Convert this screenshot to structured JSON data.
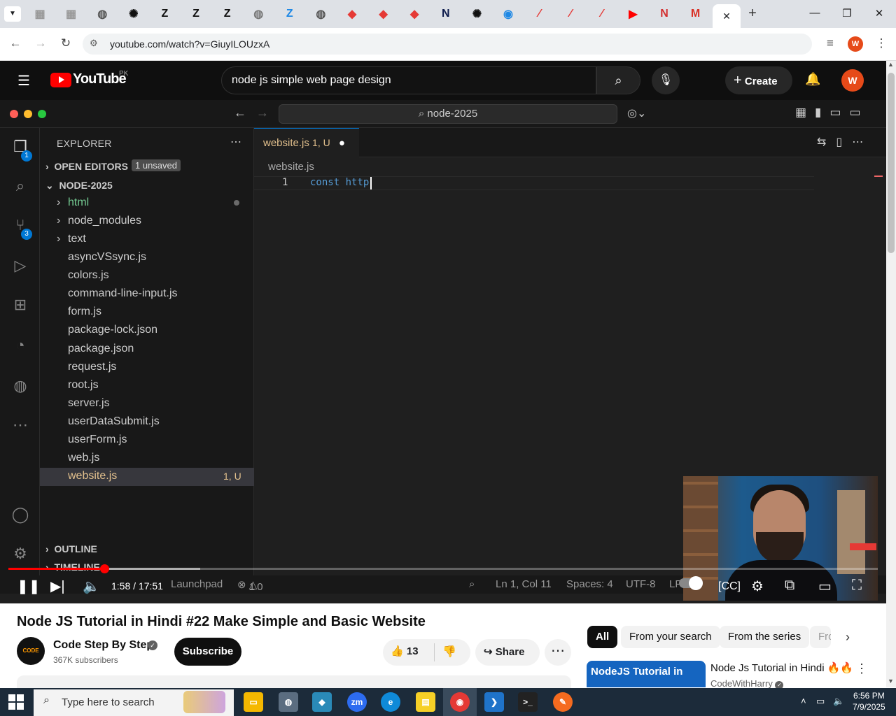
{
  "browser": {
    "url": "youtube.com/watch?v=GiuyILOUzxA",
    "tabs": [
      {
        "icon": "page-icon",
        "color": "#999"
      },
      {
        "icon": "page-icon",
        "color": "#999"
      },
      {
        "icon": "globe-icon",
        "color": "#555"
      },
      {
        "icon": "openai-icon",
        "color": "#111"
      },
      {
        "icon": "z-icon",
        "color": "#111"
      },
      {
        "icon": "z-icon",
        "color": "#111"
      },
      {
        "icon": "z-icon",
        "color": "#111"
      },
      {
        "icon": "globe-icon",
        "color": "#777"
      },
      {
        "icon": "z-icon",
        "color": "#1e88e5"
      },
      {
        "icon": "globe-icon",
        "color": "#555"
      },
      {
        "icon": "tag-icon",
        "color": "#e53935"
      },
      {
        "icon": "tag-icon",
        "color": "#e53935"
      },
      {
        "icon": "tag-icon",
        "color": "#e53935"
      },
      {
        "icon": "n-icon",
        "color": "#0d1b4c"
      },
      {
        "icon": "openai-icon",
        "color": "#111"
      },
      {
        "icon": "copilot-icon",
        "color": "#1e88e5"
      },
      {
        "icon": "slash-icon",
        "color": "#e53935"
      },
      {
        "icon": "slash-icon",
        "color": "#e53935"
      },
      {
        "icon": "slash-icon",
        "color": "#e53935"
      },
      {
        "icon": "youtube-icon",
        "color": "#ff0000"
      },
      {
        "icon": "n-icon",
        "color": "#d32f2f"
      },
      {
        "icon": "gmail-icon",
        "color": "#d93025"
      }
    ],
    "profile_initial": "W"
  },
  "youtube": {
    "logo": "YouTube",
    "country": "PK",
    "search_query": "node js simple web page design",
    "create_label": "Create",
    "avatar_initial": "W"
  },
  "vscode": {
    "search": "node-2025",
    "explorer_title": "EXPLORER",
    "open_editors": "OPEN EDITORS",
    "unsaved_badge": "1 unsaved",
    "project": "NODE-2025",
    "folders": [
      "html",
      "node_modules",
      "text"
    ],
    "files": [
      "asyncVSsync.js",
      "colors.js",
      "command-line-input.js",
      "form.js",
      "package-lock.json",
      "package.json",
      "request.js",
      "root.js",
      "server.js",
      "userDataSubmit.js",
      "userForm.js",
      "web.js"
    ],
    "selected_file": "website.js",
    "selected_status": "1, U",
    "outline": "OUTLINE",
    "timeline": "TIMELINE",
    "explorer_badge": "1",
    "scm_badge": "3",
    "tab_label": "website.js",
    "tab_status": "1, U",
    "breadcrumb": "website.js",
    "line_number": "1",
    "code_keyword": "const",
    "code_ident": "http",
    "status": {
      "launchpad": "Launchpad",
      "errors": "1",
      "warnings": "0",
      "position": "Ln 1, Col 11",
      "spaces": "Spaces: 4",
      "encoding": "UTF-8",
      "eol": "LF"
    }
  },
  "player": {
    "time": "1:58 / 17:51",
    "progress": 0.11
  },
  "video": {
    "title": "Node JS Tutorial in Hindi #22 Make Simple and Basic Website",
    "channel": "Code Step By Step",
    "channel_avatar_text": "CODE",
    "subscribers": "367K subscribers",
    "subscribe_label": "Subscribe",
    "likes": "13",
    "share_label": "Share"
  },
  "chips": [
    "All",
    "From your search",
    "From the series",
    "Fro"
  ],
  "recommendation": {
    "thumb_text": "NodeJS Tutorial in",
    "title": "Node Js Tutorial in Hindi 🔥🔥",
    "channel": "CodeWithHarry"
  },
  "taskbar": {
    "search_placeholder": "Type here to search",
    "time": "6:56 PM",
    "date": "7/9/2025"
  }
}
